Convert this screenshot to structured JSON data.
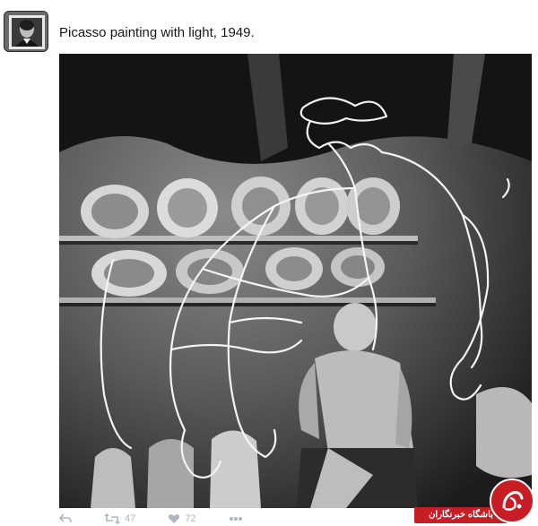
{
  "tweet": {
    "text": "Picasso painting with light, 1949.",
    "avatar_icon": "portrait-avatar-icon"
  },
  "actions": {
    "reply_icon": "reply-icon",
    "retweet_icon": "retweet-icon",
    "retweet_count": "47",
    "like_icon": "heart-icon",
    "like_count": "72",
    "more_icon": "more-dots-icon"
  },
  "watermark": {
    "text": "باشگاه خبرنگاران",
    "color": "#c81d25"
  },
  "colors": {
    "text": "#14171a",
    "action_gray": "#aab8c2"
  }
}
